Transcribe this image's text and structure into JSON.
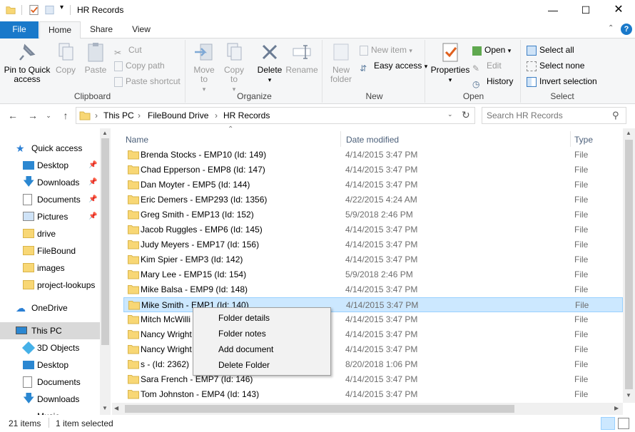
{
  "window": {
    "title": "HR Records"
  },
  "tabs": [
    "File",
    "Home",
    "Share",
    "View"
  ],
  "ribbon": {
    "clipboard": {
      "label": "Clipboard",
      "pin": "Pin to Quick access",
      "copy": "Copy",
      "paste": "Paste",
      "cut": "Cut",
      "copy_path": "Copy path",
      "paste_shortcut": "Paste shortcut"
    },
    "organize": {
      "label": "Organize",
      "move_to": "Move to",
      "copy_to": "Copy to",
      "delete": "Delete",
      "rename": "Rename"
    },
    "new": {
      "label": "New",
      "new_folder": "New folder",
      "new_item": "New item",
      "easy_access": "Easy access"
    },
    "open": {
      "label": "Open",
      "properties": "Properties",
      "open": "Open",
      "edit": "Edit",
      "history": "History"
    },
    "select": {
      "label": "Select",
      "select_all": "Select all",
      "select_none": "Select none",
      "invert": "Invert selection"
    }
  },
  "address": {
    "crumbs": [
      "This PC",
      "FileBound Drive",
      "HR Records"
    ],
    "search_placeholder": "Search HR Records"
  },
  "nav": {
    "quick_access": "Quick access",
    "pinned": [
      "Desktop",
      "Downloads",
      "Documents",
      "Pictures"
    ],
    "folders": [
      "drive",
      "FileBound",
      "images",
      "project-lookups"
    ],
    "onedrive": "OneDrive",
    "this_pc": "This PC",
    "pc_items": [
      "3D Objects",
      "Desktop",
      "Documents",
      "Downloads",
      "Music"
    ]
  },
  "columns": {
    "name": "Name",
    "date": "Date modified",
    "type": "Type"
  },
  "files": [
    {
      "name": "Brenda Stocks - EMP10 (Id: 149)",
      "date": "4/14/2015 3:47 PM",
      "type": "File"
    },
    {
      "name": "Chad Epperson - EMP8 (Id: 147)",
      "date": "4/14/2015 3:47 PM",
      "type": "File"
    },
    {
      "name": "Dan Moyter - EMP5 (Id: 144)",
      "date": "4/14/2015 3:47 PM",
      "type": "File"
    },
    {
      "name": "Eric Demers - EMP293 (Id: 1356)",
      "date": "4/22/2015 4:24 AM",
      "type": "File"
    },
    {
      "name": "Greg Smith - EMP13 (Id: 152)",
      "date": "5/9/2018 2:46 PM",
      "type": "File"
    },
    {
      "name": "Jacob Ruggles - EMP6 (Id: 145)",
      "date": "4/14/2015 3:47 PM",
      "type": "File"
    },
    {
      "name": "Judy Meyers - EMP17 (Id: 156)",
      "date": "4/14/2015 3:47 PM",
      "type": "File"
    },
    {
      "name": "Kim Spier - EMP3 (Id: 142)",
      "date": "4/14/2015 3:47 PM",
      "type": "File"
    },
    {
      "name": "Mary Lee - EMP15 (Id: 154)",
      "date": "5/9/2018 2:46 PM",
      "type": "File"
    },
    {
      "name": "Mike Balsa - EMP9 (Id: 148)",
      "date": "4/14/2015 3:47 PM",
      "type": "File"
    },
    {
      "name": "Mike Smith - EMP1 (Id: 140)",
      "date": "4/14/2015 3:47 PM",
      "type": "File"
    },
    {
      "name": "Mitch McWilli",
      "date": "4/14/2015 3:47 PM",
      "type": "File"
    },
    {
      "name": "Nancy Wright",
      "date": "4/14/2015 3:47 PM",
      "type": "File"
    },
    {
      "name": "Nancy Wright",
      "date": "4/14/2015 3:47 PM",
      "type": "File"
    },
    {
      "name": "s  -  (Id: 2362)",
      "date": "8/20/2018 1:06 PM",
      "type": "File"
    },
    {
      "name": "Sara French - EMP7 (Id: 146)",
      "date": "4/14/2015 3:47 PM",
      "type": "File"
    },
    {
      "name": "Tom Johnston - EMP4 (Id: 143)",
      "date": "4/14/2015 3:47 PM",
      "type": "File"
    }
  ],
  "context_menu": [
    "Folder details",
    "Folder notes",
    "Add document",
    "Delete Folder"
  ],
  "status": {
    "count": "21 items",
    "selected": "1 item selected"
  },
  "colors": {
    "accent": "#1979ca",
    "selection": "#cce8ff",
    "folder": "#f8d775"
  }
}
